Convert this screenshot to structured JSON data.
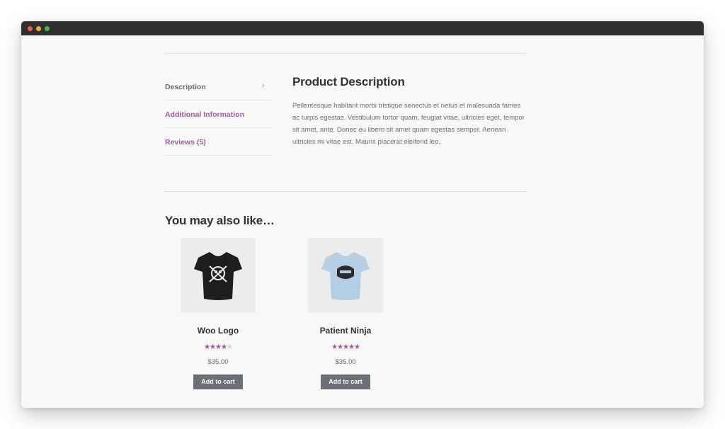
{
  "window": {
    "controls": [
      "close",
      "minimize",
      "maximize"
    ]
  },
  "tabs": [
    {
      "label": "Description",
      "active": true
    },
    {
      "label": "Additional Information",
      "active": false
    },
    {
      "label": "Reviews (5)",
      "active": false
    }
  ],
  "tab_chevron": "›",
  "description": {
    "title": "Product Description",
    "body": "Pellentesque habitant morbi tristique senectus et netus et malesuada fames ac turpis egestas. Vestibulum tortor quam, feugiat vitae, ultricies eget, tempor sit amet, ante. Donec eu libero sit amet quam egestas semper. Aenean ultricies mi vitae est. Mauris placerat eleifend leo."
  },
  "related": {
    "title": "You may also like…",
    "products": [
      {
        "name": "Woo Logo",
        "price": "$35.00",
        "rating": 4,
        "rating_max": 5,
        "button": "Add to cart",
        "shirt_color": "#1e1e1e",
        "icon": "tshirt-icon"
      },
      {
        "name": "Patient Ninja",
        "price": "$35.00",
        "rating": 5,
        "rating_max": 5,
        "button": "Add to cart",
        "shirt_color": "#b4cfe4",
        "icon": "tshirt-icon"
      }
    ]
  },
  "colors": {
    "accent": "#9f5e9a",
    "button": "#6b6f77",
    "heading": "#333333"
  }
}
